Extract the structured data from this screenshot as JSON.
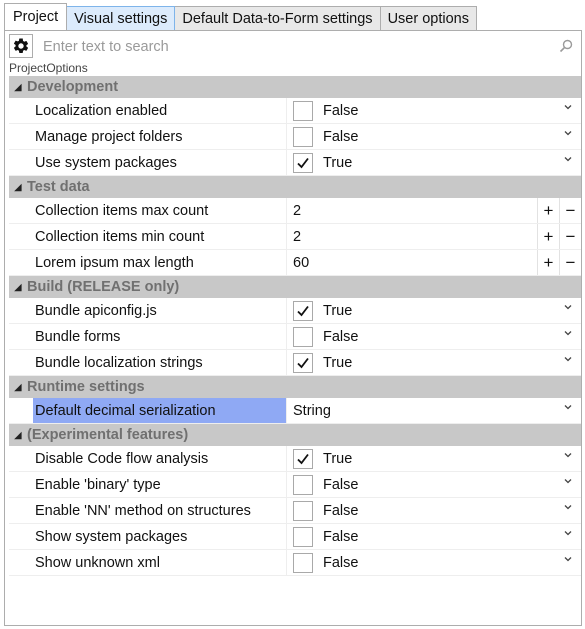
{
  "tabs": [
    {
      "label": "Project"
    },
    {
      "label": "Visual settings"
    },
    {
      "label": "Default Data-to-Form settings"
    },
    {
      "label": "User options"
    }
  ],
  "search": {
    "placeholder": "Enter text to search"
  },
  "object_caption": "ProjectOptions",
  "categories": [
    {
      "title": "Development",
      "rows": [
        {
          "name": "Localization enabled",
          "value": "False",
          "checked": false
        },
        {
          "name": "Manage project folders",
          "value": "False",
          "checked": false
        },
        {
          "name": "Use system packages",
          "value": "True",
          "checked": true
        }
      ]
    },
    {
      "title": "Test data",
      "rows": [
        {
          "name": "Collection items max count",
          "value": "2"
        },
        {
          "name": "Collection items min count",
          "value": "2"
        },
        {
          "name": "Lorem ipsum max length",
          "value": "60"
        }
      ]
    },
    {
      "title": "Build (RELEASE only)",
      "rows": [
        {
          "name": "Bundle apiconfig.js",
          "value": "True",
          "checked": true
        },
        {
          "name": "Bundle forms",
          "value": "False",
          "checked": false
        },
        {
          "name": "Bundle localization strings",
          "value": "True",
          "checked": true
        }
      ]
    },
    {
      "title": "Runtime settings",
      "rows": [
        {
          "name": "Default decimal serialization",
          "value": "String"
        }
      ]
    },
    {
      "title": "(Experimental features)",
      "rows": [
        {
          "name": "Disable Code flow analysis",
          "value": "True",
          "checked": true
        },
        {
          "name": "Enable 'binary' type",
          "value": "False",
          "checked": false
        },
        {
          "name": "Enable 'NN' method on structures",
          "value": "False",
          "checked": false
        },
        {
          "name": "Show system packages",
          "value": "False",
          "checked": false
        },
        {
          "name": "Show unknown xml",
          "value": "False",
          "checked": false
        }
      ]
    }
  ],
  "icons": {
    "settings": "gear-icon",
    "search": "search-icon",
    "collapse": "triangle-down-icon",
    "dropdown": "chevron-down-icon",
    "checkmark": "check-icon"
  },
  "colors": {
    "category_bg": "#c8c8c8",
    "category_text": "#707070",
    "selection": "#8fa9f4",
    "tab_hover": "#dcebfc"
  }
}
